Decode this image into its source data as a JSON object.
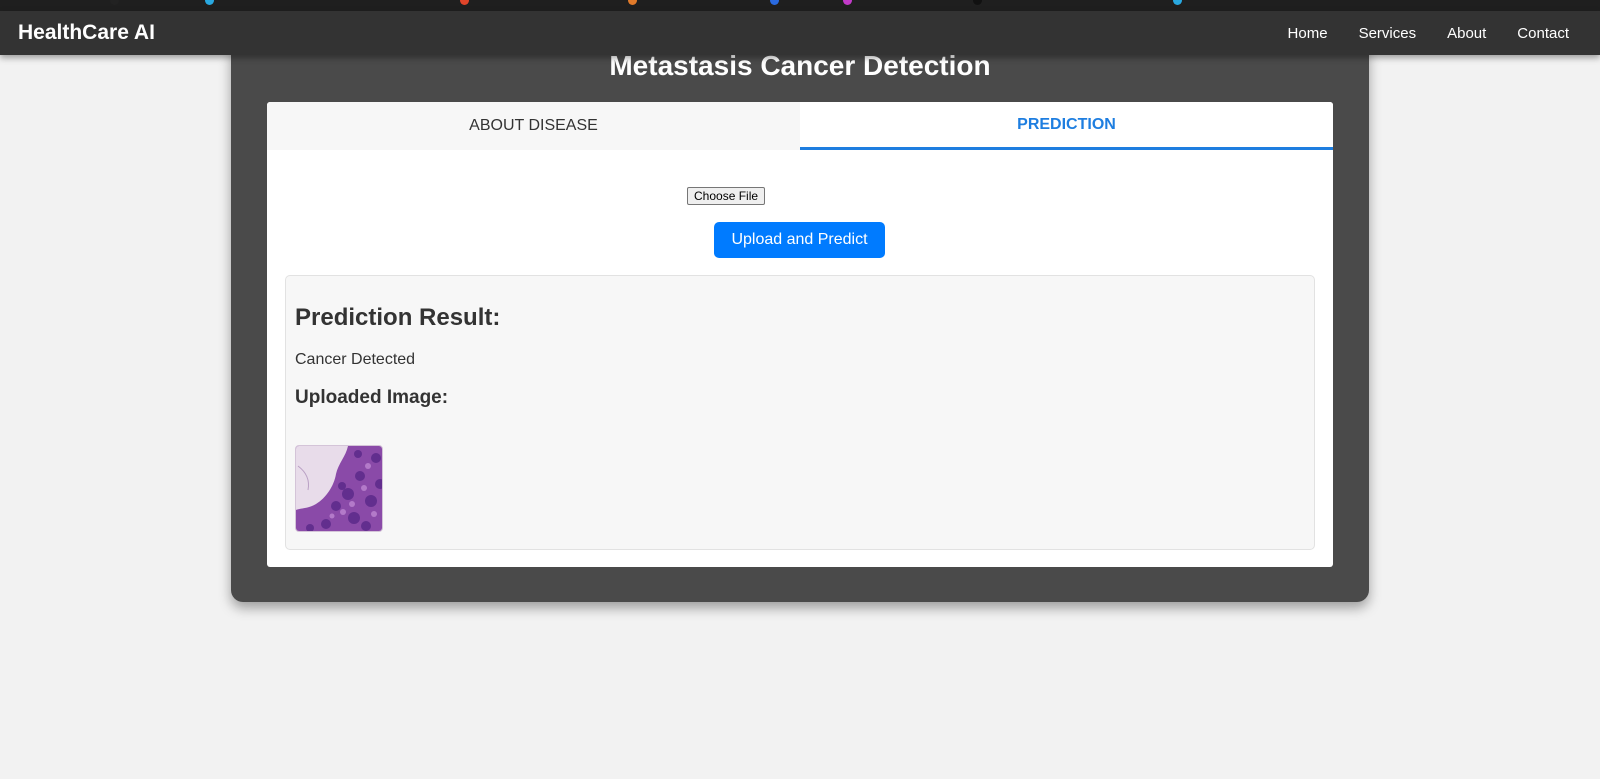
{
  "navbar": {
    "brand": "HealthCare AI",
    "links": [
      "Home",
      "Services",
      "About",
      "Contact"
    ]
  },
  "page": {
    "title": "Metastasis Cancer Detection"
  },
  "tabs": [
    {
      "label": "ABOUT DISEASE",
      "active": false
    },
    {
      "label": "PREDICTION",
      "active": true
    }
  ],
  "form": {
    "file_button_label": "Choose File",
    "upload_button_label": "Upload and Predict"
  },
  "result": {
    "heading": "Prediction Result:",
    "text": "Cancer Detected",
    "image_heading": "Uploaded Image:"
  },
  "colors": {
    "navbar_bg": "#333333",
    "card_bg": "#4a4a4a",
    "accent": "#007bff",
    "active_tab": "#1e7ee0",
    "page_bg": "#f2f2f2"
  },
  "icons": [
    "histology-thumbnail-image"
  ]
}
